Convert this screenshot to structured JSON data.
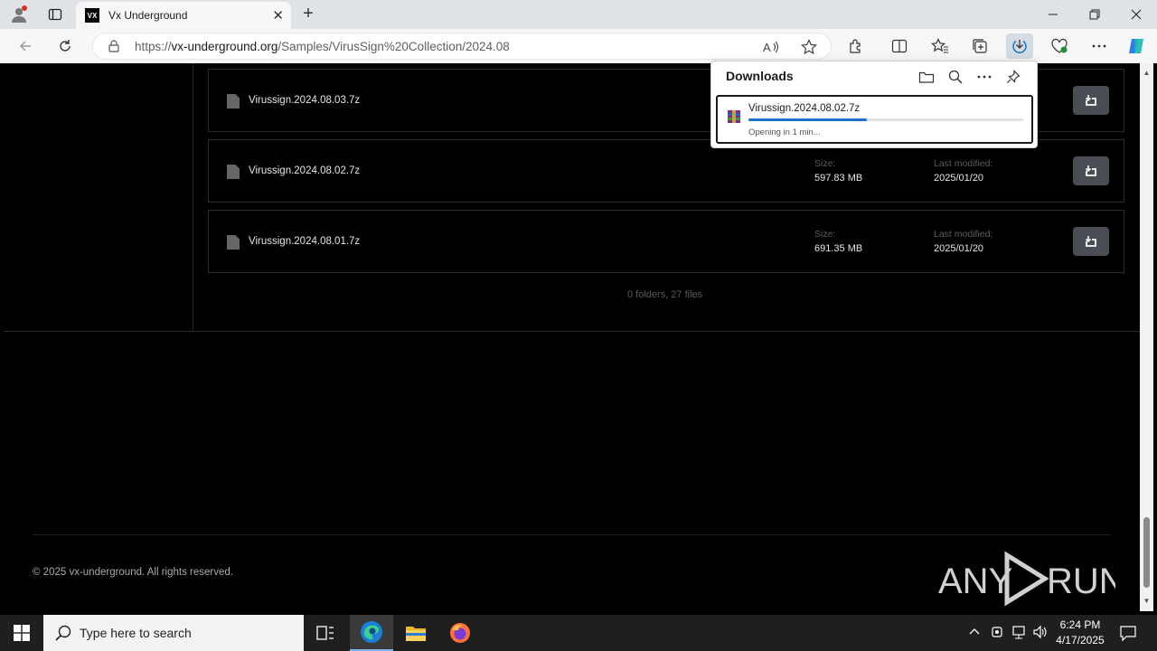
{
  "browser": {
    "tab_title": "Vx Underground",
    "tab_favicon_text": "VX",
    "url_prefix": "https://",
    "url_host": "vx-underground.org",
    "url_path": "/Samples/VirusSign%20Collection/2024.08"
  },
  "files": [
    {
      "name": "Virussign.2024.08.03.7z",
      "size_label": "",
      "size": "",
      "modified_label": "",
      "modified": ""
    },
    {
      "name": "Virussign.2024.08.02.7z",
      "size_label": "Size:",
      "size": "597.83 MB",
      "modified_label": "Last modified:",
      "modified": "2025/01/20"
    },
    {
      "name": "Virussign.2024.08.01.7z",
      "size_label": "Size:",
      "size": "691.35 MB",
      "modified_label": "Last modified:",
      "modified": "2025/01/20"
    }
  ],
  "summary": "0 folders, 27 files",
  "footer": {
    "copyright": "© 2025 vx-underground. All rights reserved."
  },
  "watermark": {
    "left": "ANY",
    "right": "RUN"
  },
  "downloads_panel": {
    "title": "Downloads",
    "item": {
      "filename": "Virussign.2024.08.02.7z",
      "status": "Opening in 1 min...",
      "progress": 0.43
    }
  },
  "taskbar": {
    "search_placeholder": "Type here to search",
    "time": "6:24 PM",
    "date": "4/17/2025"
  },
  "colors": {
    "progress": "#1a73c8",
    "page_bg": "#000000"
  }
}
